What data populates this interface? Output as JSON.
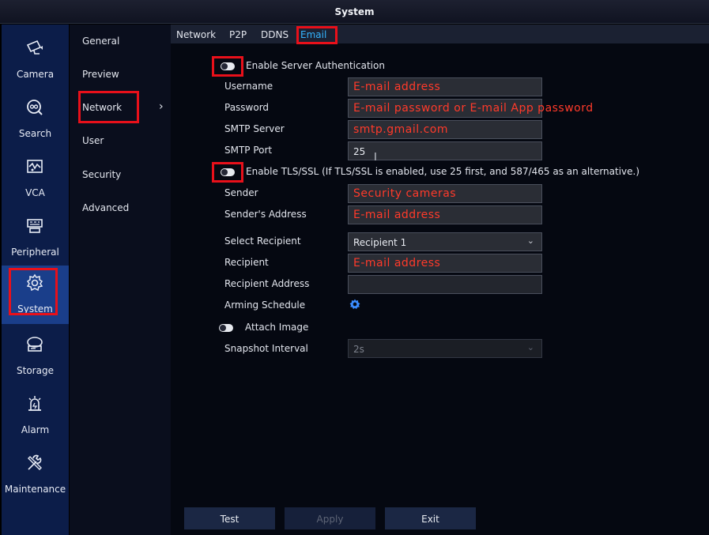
{
  "window": {
    "title": "System"
  },
  "leftnav": {
    "items": [
      {
        "label": "Camera",
        "icon": "camera-icon"
      },
      {
        "label": "Search",
        "icon": "search-icon"
      },
      {
        "label": "VCA",
        "icon": "vca-icon"
      },
      {
        "label": "Peripheral",
        "icon": "peripheral-icon"
      },
      {
        "label": "System",
        "icon": "system-gear-icon",
        "active": true
      },
      {
        "label": "Storage",
        "icon": "storage-icon"
      },
      {
        "label": "Alarm",
        "icon": "alarm-icon"
      },
      {
        "label": "Maintenance",
        "icon": "maintenance-icon"
      }
    ]
  },
  "subnav": {
    "items": [
      {
        "label": "General"
      },
      {
        "label": "Preview"
      },
      {
        "label": "Network",
        "active": true,
        "arrow": "›"
      },
      {
        "label": "User"
      },
      {
        "label": "Security"
      },
      {
        "label": "Advanced"
      }
    ]
  },
  "tabs": [
    {
      "label": "Network"
    },
    {
      "label": "P2P"
    },
    {
      "label": "DDNS"
    },
    {
      "label": "Email",
      "active": true
    }
  ],
  "form": {
    "server_auth": {
      "label": "Enable Server Authentication",
      "enabled": false
    },
    "username": {
      "label": "Username",
      "value": "E-mail address"
    },
    "password": {
      "label": "Password",
      "value": "E-mail password or E-mail App password"
    },
    "smtp_server": {
      "label": "SMTP Server",
      "value": "smtp.gmail.com"
    },
    "smtp_port": {
      "label": "SMTP Port",
      "value": "25"
    },
    "tls": {
      "label": "Enable TLS/SSL (If TLS/SSL is enabled, use 25 first, and 587/465 as an alternative.)",
      "enabled": false
    },
    "sender": {
      "label": "Sender",
      "value": "Security cameras"
    },
    "sender_address": {
      "label": "Sender's Address",
      "value": "E-mail address"
    },
    "select_recipient": {
      "label": "Select Recipient",
      "value": "Recipient 1"
    },
    "recipient": {
      "label": "Recipient",
      "value": "E-mail address"
    },
    "recipient_address": {
      "label": "Recipient Address",
      "value": ""
    },
    "arming_schedule": {
      "label": "Arming Schedule"
    },
    "attach_image": {
      "label": "Attach Image",
      "enabled": false
    },
    "snapshot_interval": {
      "label": "Snapshot Interval",
      "value": "2s"
    }
  },
  "buttons": {
    "test": "Test",
    "apply": "Apply",
    "exit": "Exit"
  },
  "colors": {
    "accent": "#34b4ff",
    "highlight": "#e8101a",
    "annotation_text": "#ff3a2a",
    "nav_bg": "#0c1d49"
  }
}
